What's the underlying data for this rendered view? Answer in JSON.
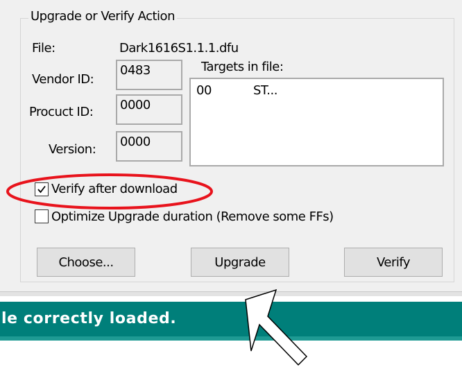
{
  "group": {
    "title": "Upgrade or Verify Action"
  },
  "file": {
    "label": "File:",
    "value": "Dark1616S1.1.1.dfu"
  },
  "vendor_id": {
    "label": "Vendor ID:",
    "value": "0483"
  },
  "product_id": {
    "label": "Procuct ID:",
    "value": "0000"
  },
  "version": {
    "label": "Version:",
    "value": "0000"
  },
  "targets": {
    "label": "Targets in file:",
    "rows": [
      {
        "id": "00",
        "name": "ST..."
      }
    ]
  },
  "verify_after_download": {
    "label": "Verify after download",
    "checked": true
  },
  "optimize_upgrade": {
    "label": "Optimize Upgrade duration (Remove some FFs)",
    "checked": false
  },
  "buttons": {
    "choose": "Choose...",
    "upgrade": "Upgrade",
    "verify": "Verify"
  },
  "status": {
    "text": "le correctly loaded."
  },
  "colors": {
    "status_bar": "#007f7a",
    "annotation": "#e8131c",
    "dialog_bg": "#f0f0f0"
  }
}
